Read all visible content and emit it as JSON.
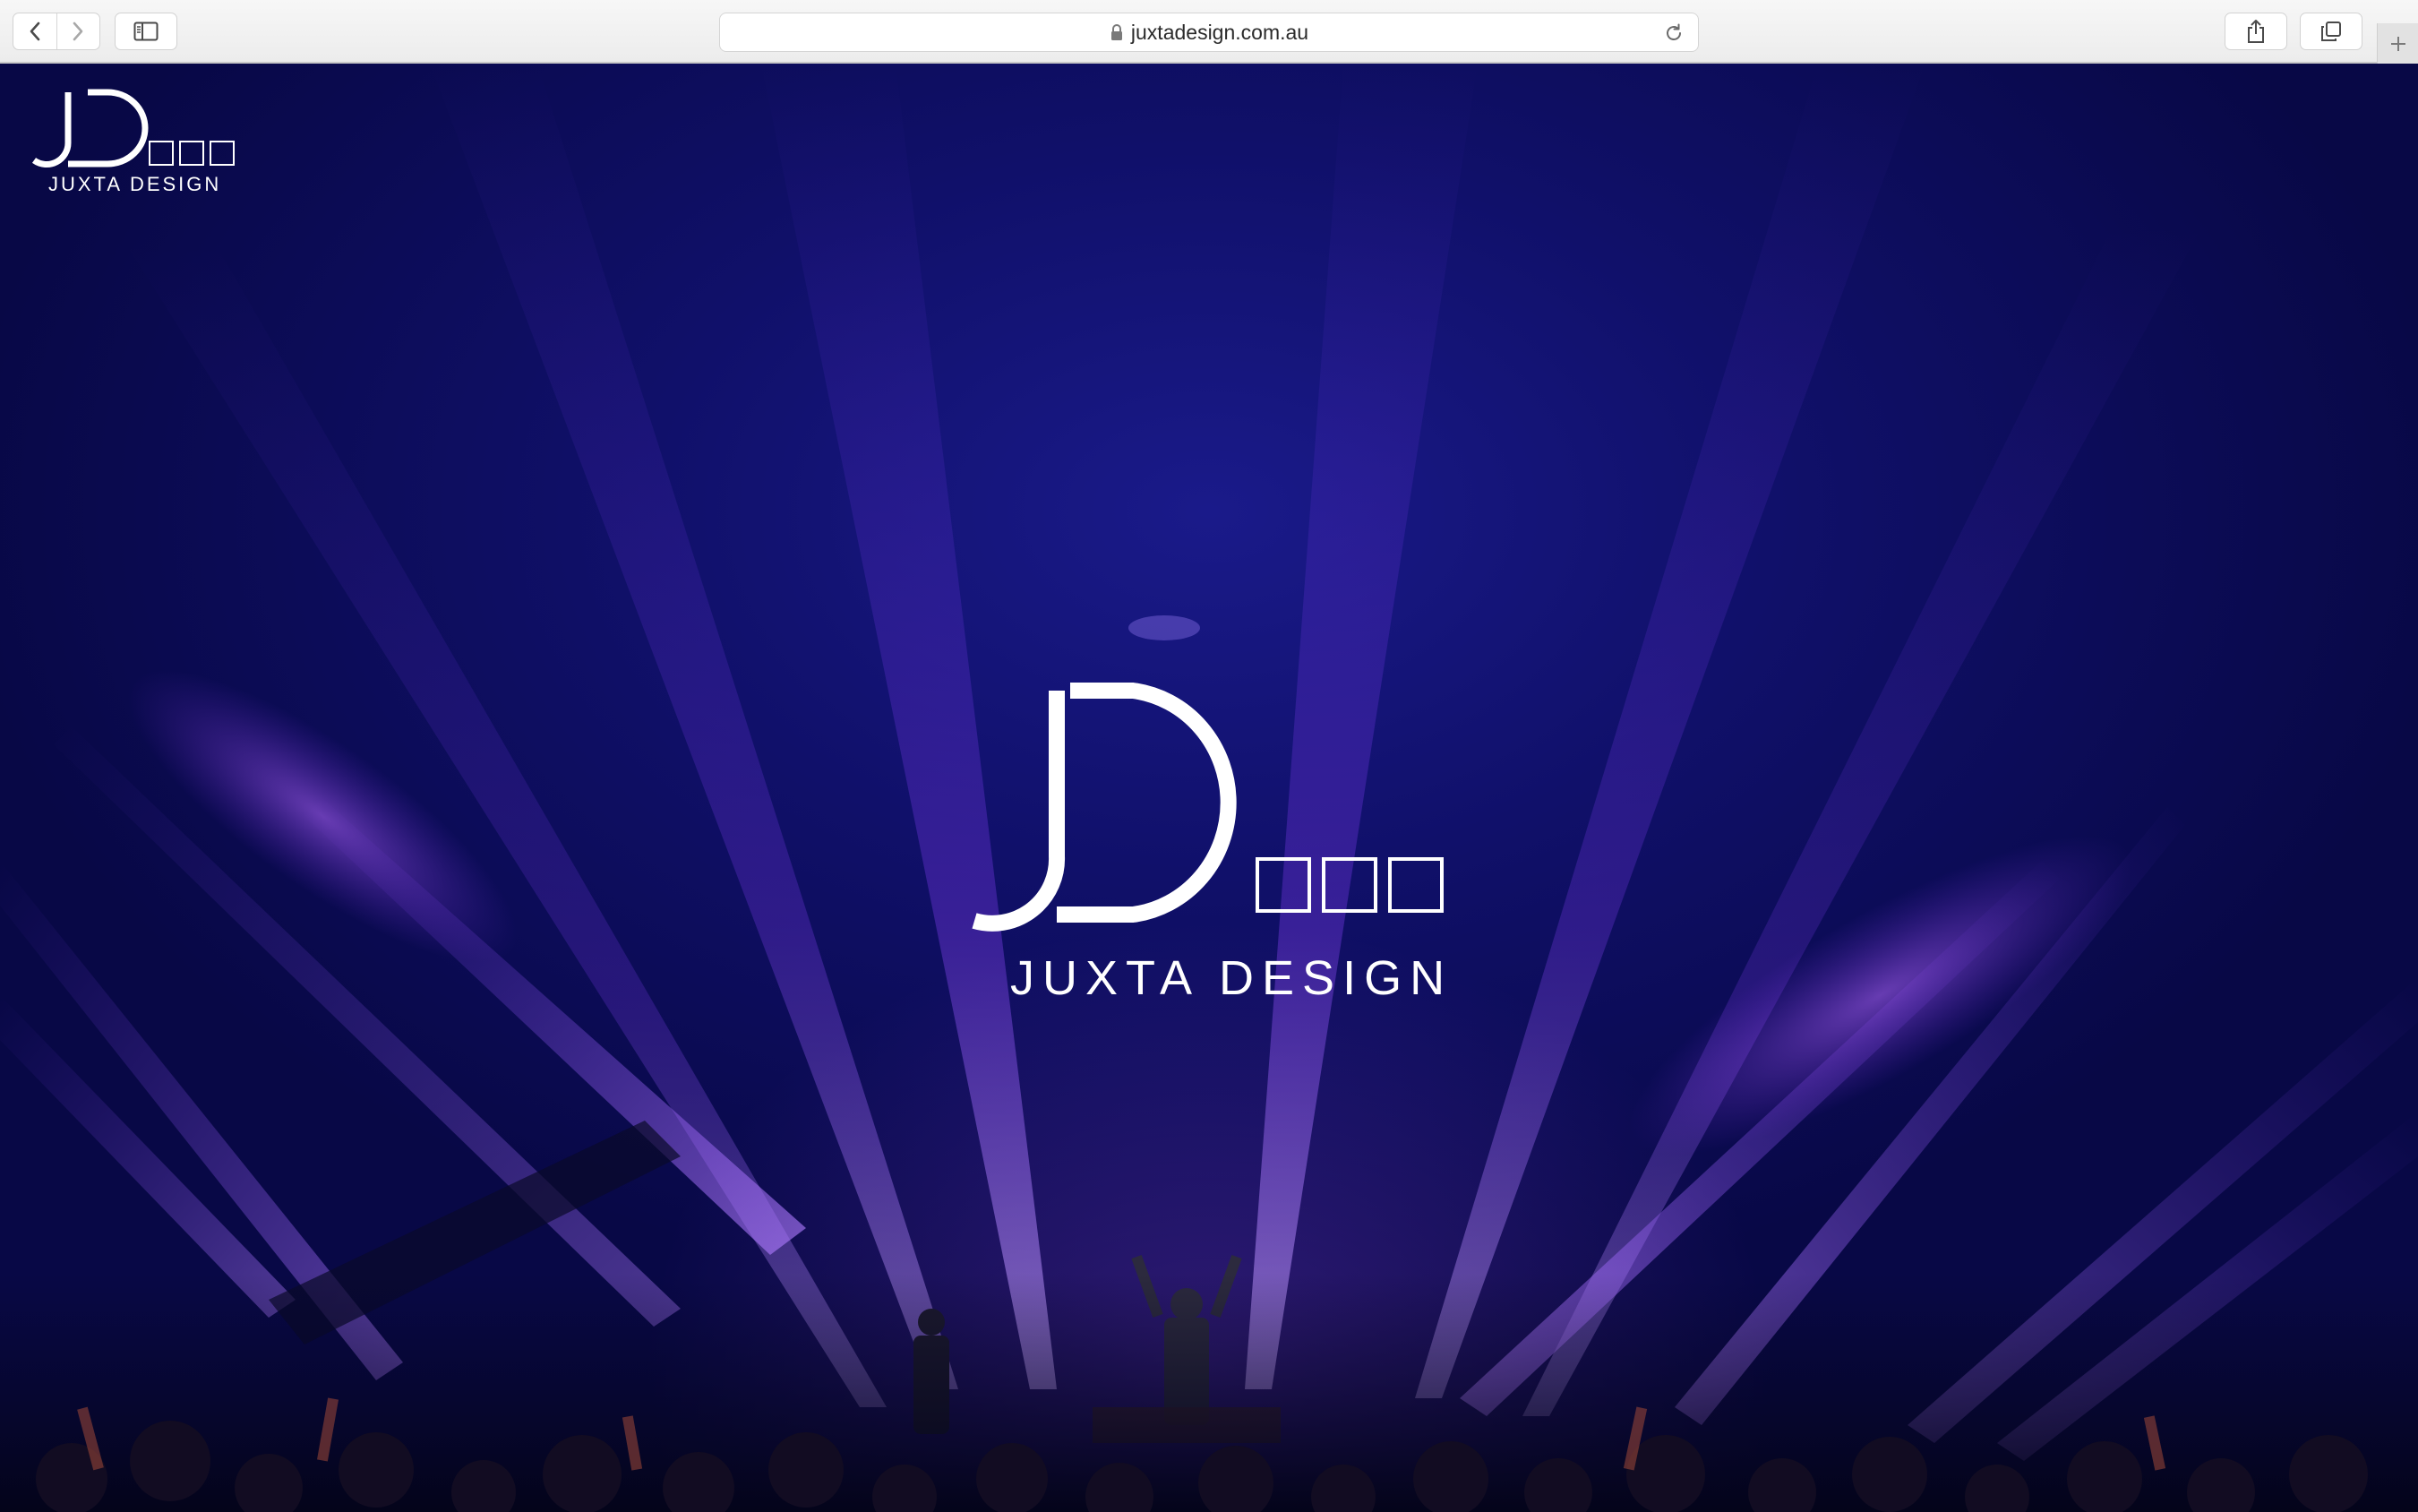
{
  "browser": {
    "url": "juxtadesign.com.au",
    "icons": {
      "back": "chevron-left-icon",
      "forward": "chevron-right-icon",
      "sidebar": "sidebar-icon",
      "lock": "lock-icon",
      "reload": "reload-icon",
      "share": "share-icon",
      "tabs": "tabs-overview-icon",
      "new_tab": "plus-icon"
    }
  },
  "site": {
    "brand_name": "JUXTA DESIGN",
    "logo_letters": "JD",
    "colors": {
      "background": "#10106a",
      "beam": "#8a3cf0",
      "logo": "#ffffff"
    }
  }
}
